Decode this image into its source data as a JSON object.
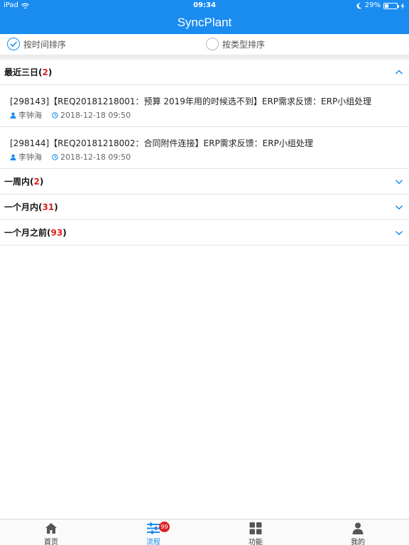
{
  "status": {
    "device": "iPad",
    "time": "09:34",
    "battery_text": "29%",
    "battery_level": 0.29
  },
  "nav": {
    "title": "SyncPlant"
  },
  "sort": {
    "by_time": {
      "label": "按时间排序",
      "checked": true
    },
    "by_type": {
      "label": "按类型排序",
      "checked": false
    }
  },
  "sections": [
    {
      "label": "最近三日",
      "count": "2",
      "expanded": true
    },
    {
      "label": "一周内",
      "count": "2",
      "expanded": false
    },
    {
      "label": "一个月内",
      "count": "31",
      "expanded": false
    },
    {
      "label": "一个月之前",
      "count": "93",
      "expanded": false
    }
  ],
  "entries": [
    {
      "title": "[298143]【REQ20181218001：预算 2019年用的时候选不到】ERP需求反馈：ERP小组处理",
      "user": "李钟海",
      "datetime": "2018-12-18 09:50"
    },
    {
      "title": "[298144]【REQ20181218002：合同附件连接】ERP需求反馈：ERP小组处理",
      "user": "李钟海",
      "datetime": "2018-12-18 09:50"
    }
  ],
  "tabs": [
    {
      "label": "首页",
      "icon": "home-icon"
    },
    {
      "label": "流程",
      "icon": "sliders-icon",
      "badge": "99",
      "active": true
    },
    {
      "label": "功能",
      "icon": "grid-icon"
    },
    {
      "label": "我的",
      "icon": "user-icon"
    }
  ],
  "colors": {
    "accent": "#1a8cf0",
    "badge": "#e02020"
  }
}
